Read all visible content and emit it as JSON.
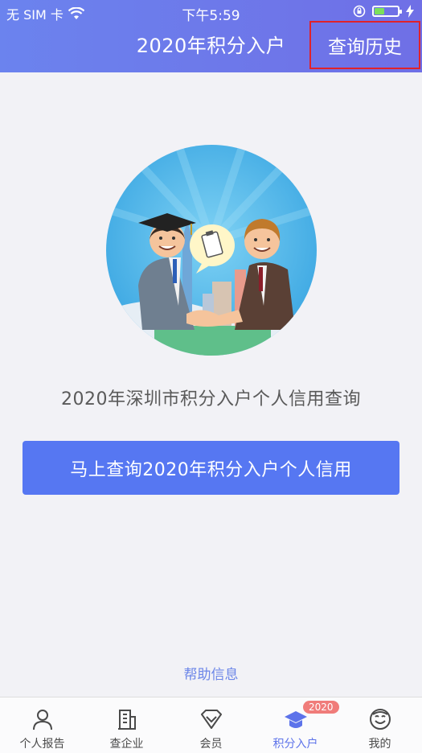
{
  "status": {
    "carrier": "无 SIM 卡",
    "time": "下午5:59"
  },
  "header": {
    "title": "2020年积分入户",
    "history_label": "查询历史"
  },
  "main": {
    "caption": "2020年深圳市积分入户个人信用查询",
    "cta_label": "马上查询2020年积分入户个人信用",
    "help_label": "帮助信息"
  },
  "tabs": [
    {
      "label": "个人报告",
      "icon": "person-icon"
    },
    {
      "label": "查企业",
      "icon": "building-icon"
    },
    {
      "label": "会员",
      "icon": "vip-icon"
    },
    {
      "label": "积分入户",
      "icon": "graduation-cap-icon",
      "badge": "2020",
      "active": true
    },
    {
      "label": "我的",
      "icon": "smiley-icon"
    }
  ],
  "colors": {
    "header": "#6b83ee",
    "accent": "#5677f2",
    "active_tab": "#5d73ea",
    "badge": "#f07c7a",
    "highlight_border": "#e0222a"
  }
}
